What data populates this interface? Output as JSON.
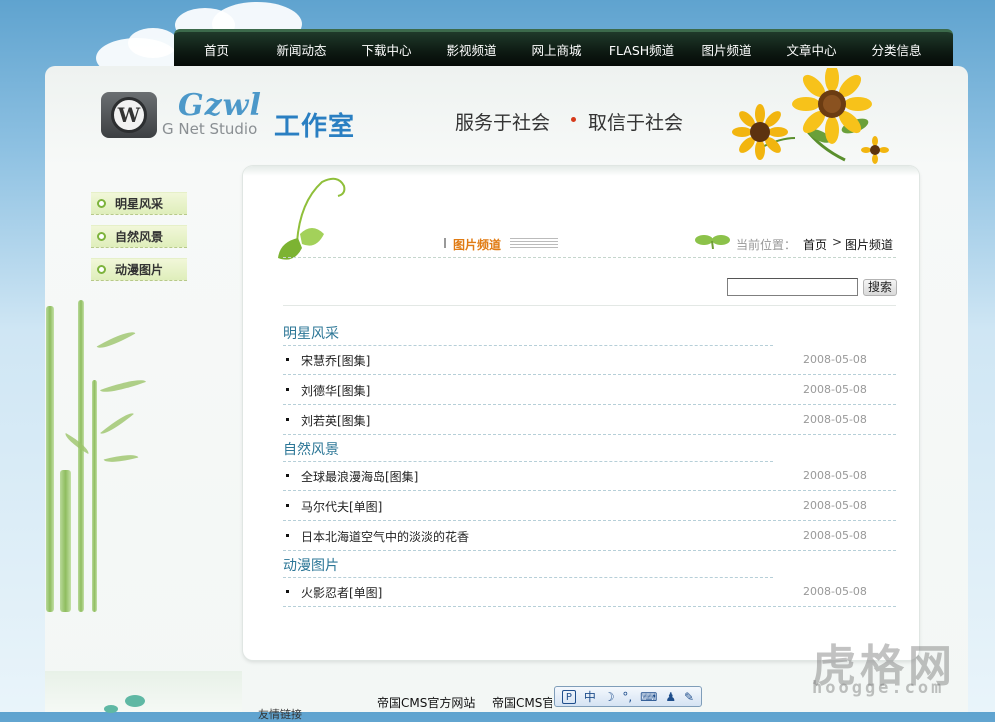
{
  "nav": {
    "items": [
      "首页",
      "新闻动态",
      "下载中心",
      "影视频道",
      "网上商城",
      "FLASH频道",
      "图片频道",
      "文章中心",
      "分类信息"
    ]
  },
  "header": {
    "logo_brand": "Gzwl",
    "logo_sub": "G Net Studio",
    "logo_cn": "工作室",
    "slogan_left": "服务于社会",
    "slogan_right": "取信于社会"
  },
  "sidebar": {
    "items": [
      {
        "label": "明星风采"
      },
      {
        "label": "自然风景"
      },
      {
        "label": "动漫图片"
      }
    ]
  },
  "channel": {
    "title": "图片频道",
    "breadcrumb_prefix": "当前位置：",
    "breadcrumb_home": "首页",
    "breadcrumb_sep": ">",
    "breadcrumb_current": "图片频道"
  },
  "search": {
    "value": "",
    "button_label": "搜索"
  },
  "categories": [
    {
      "title": "明星风采",
      "items": [
        {
          "title": "宋慧乔[图集]",
          "date": "2008-05-08"
        },
        {
          "title": "刘德华[图集]",
          "date": "2008-05-08"
        },
        {
          "title": "刘若英[图集]",
          "date": "2008-05-08"
        }
      ]
    },
    {
      "title": "自然风景",
      "items": [
        {
          "title": "全球最浪漫海岛[图集]",
          "date": "2008-05-08"
        },
        {
          "title": "马尔代夫[单图]",
          "date": "2008-05-08"
        },
        {
          "title": "日本北海道空气中的淡淡的花香",
          "date": "2008-05-08"
        }
      ]
    },
    {
      "title": "动漫图片",
      "items": [
        {
          "title": "火影忍者[单图]",
          "date": "2008-05-08"
        }
      ]
    }
  ],
  "footer": {
    "links_label": "友情链接",
    "links": [
      "帝国CMS官方网站",
      "帝国CMS官"
    ]
  },
  "ime": {
    "lang": "中"
  },
  "watermark": {
    "main": "虎格网",
    "sub": "hoogge.com"
  },
  "colors": {
    "nav_bg": "#0d1912",
    "accent_orange": "#e07b13",
    "category_blue": "#2d7797",
    "sidebar_green": "#dfeebb"
  }
}
